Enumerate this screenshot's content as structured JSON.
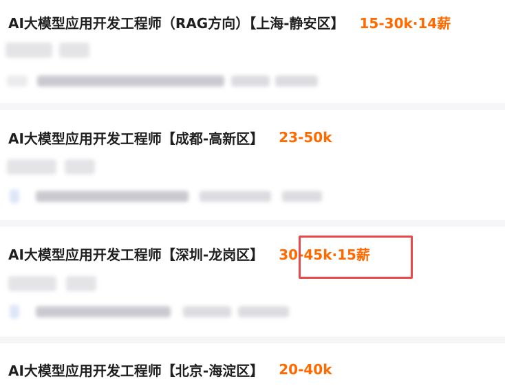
{
  "jobs": [
    {
      "title": "AI大模型应用开发工程师（RAG方向）【上海-静安区】",
      "salary": "15-30k·14薪"
    },
    {
      "title": "AI大模型应用开发工程师【成都-高新区】",
      "salary": "23-50k"
    },
    {
      "title": "AI大模型应用开发工程师【深圳-龙岗区】",
      "salary": "30-45k·15薪",
      "highlighted": true
    },
    {
      "title": "AI大模型应用开发工程师【北京-海淀区】",
      "salary": "20-40k"
    }
  ],
  "colors": {
    "title": "#1f1f1f",
    "salary": "#ff6a00",
    "highlight_border": "#e8484a",
    "divider": "#f6f6f8"
  }
}
